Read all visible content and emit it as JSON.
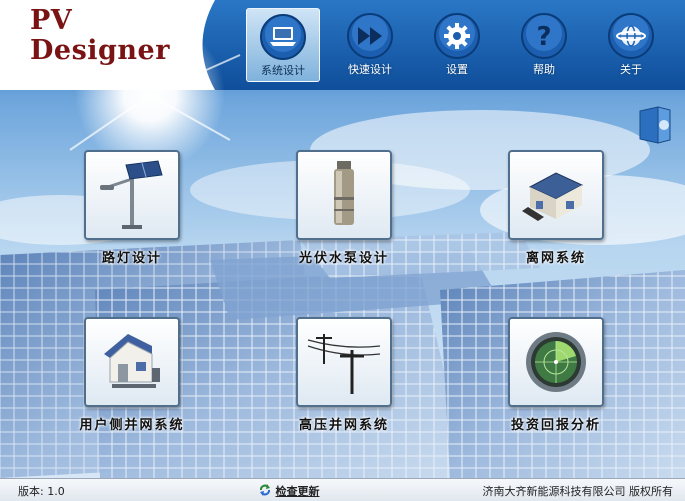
{
  "app": {
    "logo_line1": "PV",
    "logo_line2": "Designer"
  },
  "toolbar": {
    "items": [
      {
        "label": "系统设计",
        "icon": "laptop-icon",
        "active": true
      },
      {
        "label": "快速设计",
        "icon": "fast-forward-icon",
        "active": false
      },
      {
        "label": "设置",
        "icon": "gear-icon",
        "active": false
      },
      {
        "label": "帮助",
        "icon": "question-icon",
        "active": false
      },
      {
        "label": "关于",
        "icon": "globe-icon",
        "active": false
      }
    ]
  },
  "tiles": [
    {
      "label": "路灯设计",
      "icon": "street-light-icon"
    },
    {
      "label": "光伏水泵设计",
      "icon": "water-pump-icon"
    },
    {
      "label": "离网系统",
      "icon": "off-grid-house-icon"
    },
    {
      "label": "用户侧并网系统",
      "icon": "grid-house-icon"
    },
    {
      "label": "高压并网系统",
      "icon": "power-pole-icon"
    },
    {
      "label": "投资回报分析",
      "icon": "radar-icon"
    }
  ],
  "status": {
    "version": "版本: 1.0",
    "update": "检查更新",
    "copyright": "济南大齐新能源科技有限公司 版权所有"
  },
  "colors": {
    "logo": "#7a1414",
    "header_blue": "#1f68b5",
    "tile_border": "#4f6f8c"
  }
}
